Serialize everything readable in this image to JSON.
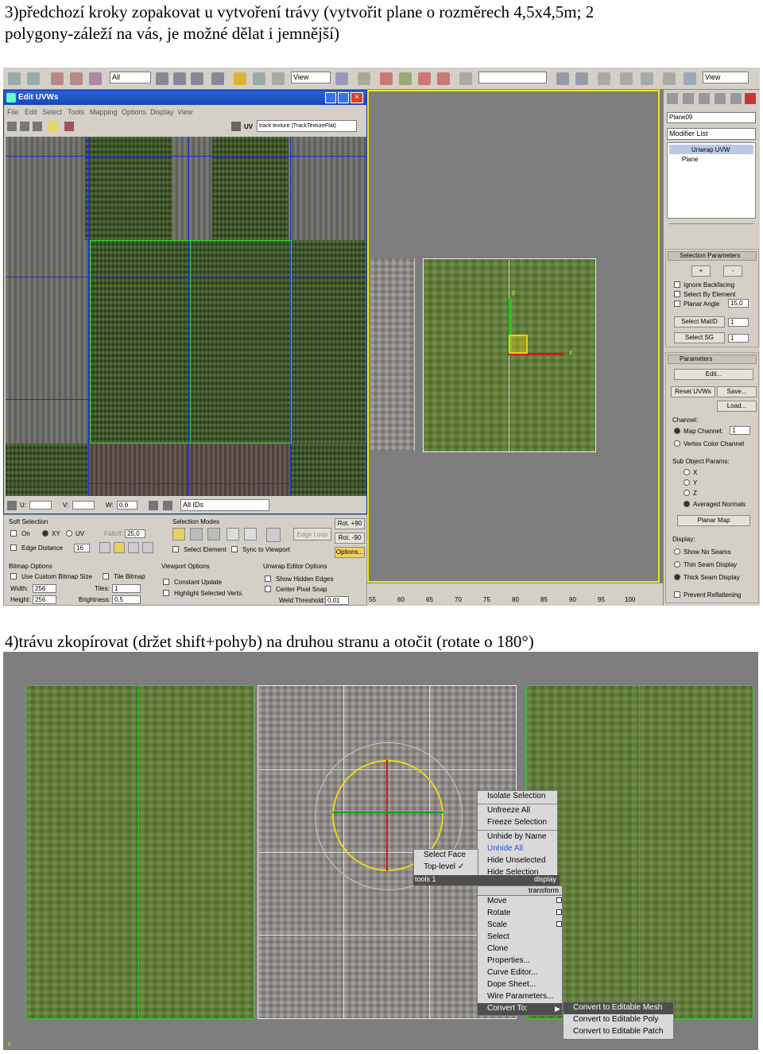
{
  "step3": {
    "text_line1": "3)předchozí kroky zopakovat u vytvoření trávy (vytvořit plane o rozměrech 4,5x4,5m; 2",
    "text_line2": "polygony-záleží na vás, je možné dělat i jemnější)"
  },
  "step4": {
    "text": "4)trávu zkopírovat (držet shift+pohyb) na druhou stranu a otočit (rotate o 180°)"
  },
  "toolbar": {
    "filter_dropdown": "All",
    "refcoord_dropdown": "View",
    "view_dropdown2": "View"
  },
  "uvw_editor": {
    "title": "Edit UVWs",
    "menu": [
      "File",
      "Edit",
      "Select",
      "Tools",
      "Mapping",
      "Options",
      "Display",
      "View"
    ],
    "map_channel_label": "UV",
    "texture_dropdown": "track texture (TrackTextureFlat)",
    "u_label": "U:",
    "v_label": "V:",
    "w_label": "W:",
    "w_value": "0,0",
    "ids_dropdown": "All IDs",
    "soft_selection": {
      "title": "Soft Selection",
      "on_label": "On",
      "xy_label": "XY",
      "uv_label": "UV",
      "falloff_label": "Falloff:",
      "falloff_value": "25,0",
      "edge_distance_label": "Edge Distance",
      "edge_distance_value": "16"
    },
    "selection_modes": {
      "title": "Selection Modes",
      "edge_loop_label": "Edge Loop",
      "select_element_label": "Select Element",
      "sync_label": "Sync to Viewport"
    },
    "rot_plus": "Rot. +90",
    "rot_minus": "Rot. -90",
    "options_button": "Options...",
    "bitmap_options": {
      "title": "Bitmap Options",
      "custom_size_label": "Use Custom Bitmap Size",
      "tile_label": "Tile Bitmap",
      "width_label": "Width:",
      "width_value": "256",
      "height_label": "Height:",
      "height_value": "256",
      "tiles_label": "Tiles:",
      "tiles_value": "1",
      "brightness_label": "Brightness:",
      "brightness_value": "0,5"
    },
    "viewport_options": {
      "title": "Viewport Options",
      "constant_update_label": "Constant Update",
      "highlight_label": "Highlight Selected Verts."
    },
    "unwrap_options": {
      "title": "Unwrap Editor Options",
      "hidden_edges_label": "Show Hidden Edges",
      "center_pixel_label": "Center Pixel Snap",
      "weld_label": "Weld Threshold:",
      "weld_value": "0,01"
    }
  },
  "viewport1": {
    "gizmo_y": "y",
    "gizmo_x": "x",
    "ruler": [
      "55",
      "60",
      "65",
      "70",
      "75",
      "80",
      "85",
      "90",
      "95",
      "100"
    ]
  },
  "command_panel": {
    "object_name": "Plane09",
    "modifier_list": "Modifier List",
    "stack": [
      "Unwrap UVW",
      "Plane"
    ],
    "selection_params": {
      "title": "Selection Parameters",
      "plus": "+",
      "minus": "-",
      "ignore_backfacing": "Ignore Backfacing",
      "select_by_element": "Select By Element",
      "planar_angle": "Planar Angle",
      "planar_angle_value": "15,0",
      "select_matid": "Select MatID",
      "select_matid_value": "1",
      "select_sg": "Select SG",
      "select_sg_value": "1"
    },
    "parameters": {
      "title": "Parameters",
      "edit": "Edit...",
      "reset": "Reset UVWs",
      "save": "Save...",
      "load": "Load...",
      "channel_label": "Channel:",
      "map_channel": "Map Channel:",
      "map_channel_value": "1",
      "vertex_color": "Vertex Color Channel",
      "sub_object": "Sub Object Params:",
      "x": "X",
      "y": "Y",
      "z": "Z",
      "averaged": "Averaged Normals",
      "planar_map": "Planar Map",
      "display_label": "Display:",
      "show_no_seams": "Show No Seams",
      "thin_seam": "Thin Seam Display",
      "thick_seam": "Thick Seam Display",
      "prevent_reflattening": "Prevent Reflattening"
    }
  },
  "context_menu": {
    "display_items": [
      "Isolate Selection",
      "Unfreeze All",
      "Freeze Selection",
      "Unhide by Name",
      "Unhide All",
      "Hide Unselected",
      "Hide Selection"
    ],
    "tools_items": [
      "Select Face",
      "Top-level"
    ],
    "tools_header": "tools 1",
    "display_header": "display",
    "transform_header": "transform",
    "transform_items": [
      "Move",
      "Rotate",
      "Scale",
      "Select",
      "Clone",
      "Properties...",
      "Curve Editor...",
      "Dope Sheet...",
      "Wire Parameters...",
      "Convert To:"
    ],
    "convert_items": [
      "Convert to Editable Mesh",
      "Convert to Editable Poly",
      "Convert to Editable Patch"
    ],
    "highlight_color": "#3050d0"
  },
  "viewport2": {
    "corner_label": "y"
  }
}
